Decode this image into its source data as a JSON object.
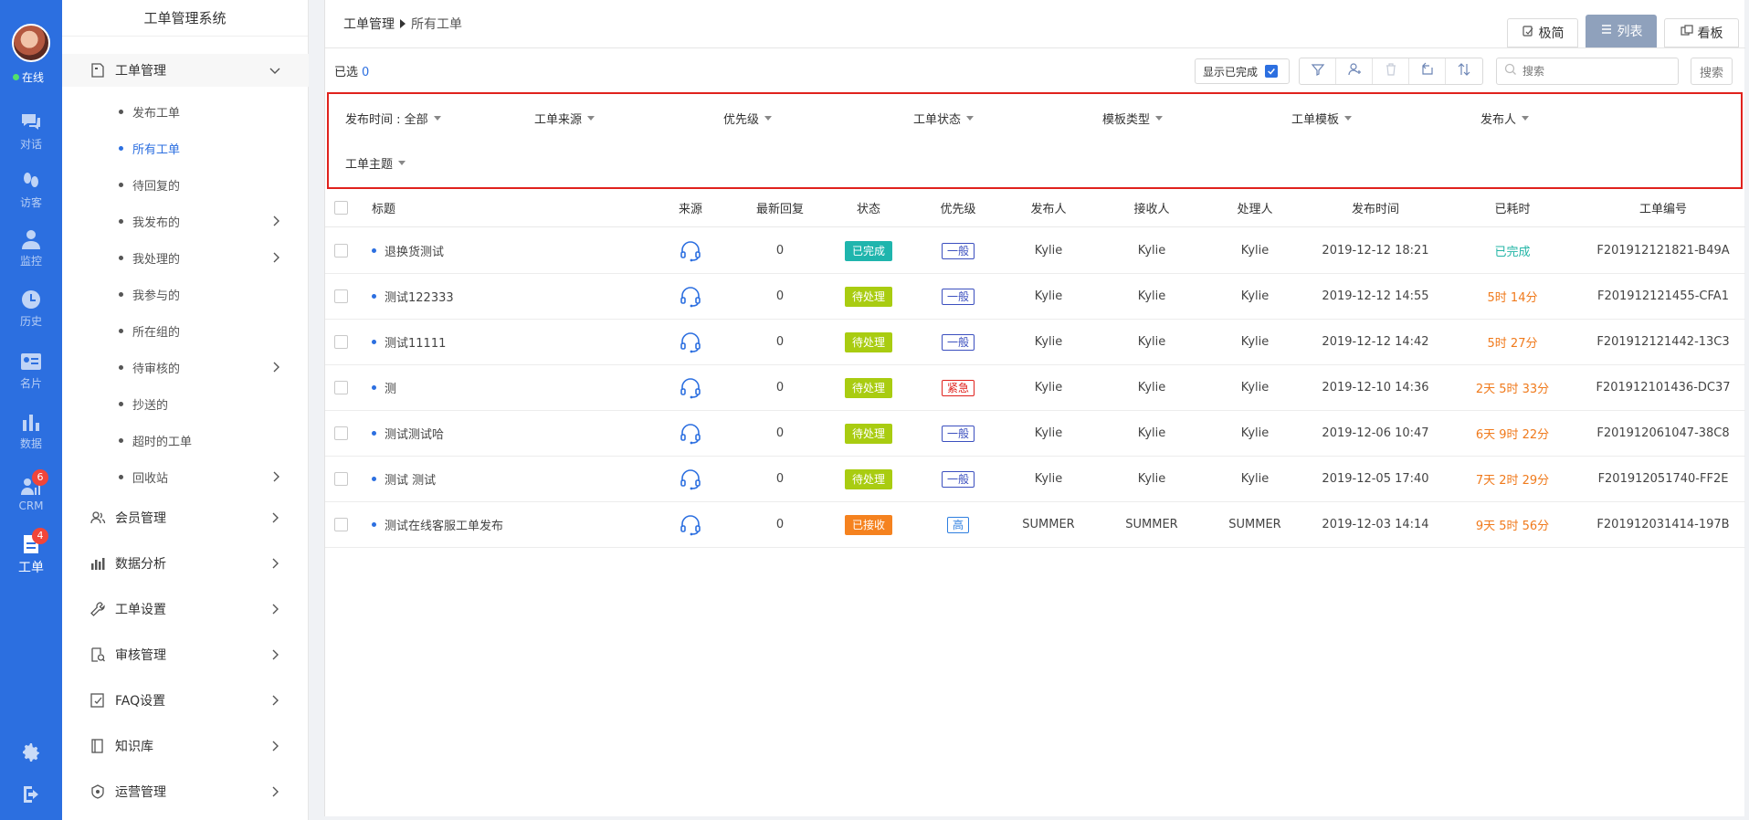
{
  "rail": {
    "status": "在线",
    "items": [
      {
        "label": "对话",
        "icon": "chat-icon",
        "active": false,
        "badge": ""
      },
      {
        "label": "访客",
        "icon": "footprint-icon",
        "active": false,
        "badge": ""
      },
      {
        "label": "监控",
        "icon": "monitor-user-icon",
        "active": false,
        "badge": ""
      },
      {
        "label": "历史",
        "icon": "clock-icon",
        "active": false,
        "badge": ""
      },
      {
        "label": "名片",
        "icon": "id-card-icon",
        "active": false,
        "badge": ""
      },
      {
        "label": "数据",
        "icon": "bar-chart-icon",
        "active": false,
        "badge": ""
      },
      {
        "label": "CRM",
        "icon": "crm-icon",
        "active": false,
        "badge": "6"
      },
      {
        "label": "工单",
        "icon": "ticket-icon",
        "active": true,
        "badge": "4"
      }
    ]
  },
  "sidebar": {
    "title": "工单管理系统",
    "groups": [
      {
        "label": "工单管理",
        "icon": "ticket-icon",
        "open": true
      },
      {
        "label": "会员管理",
        "icon": "members-icon"
      },
      {
        "label": "数据分析",
        "icon": "analytics-icon"
      },
      {
        "label": "工单设置",
        "icon": "wrench-icon"
      },
      {
        "label": "审核管理",
        "icon": "audit-icon"
      },
      {
        "label": "FAQ设置",
        "icon": "faq-icon"
      },
      {
        "label": "知识库",
        "icon": "book-icon"
      },
      {
        "label": "运营管理",
        "icon": "operations-icon"
      }
    ],
    "subitems": [
      {
        "label": "发布工单",
        "active": false,
        "arrow": false
      },
      {
        "label": "所有工单",
        "active": true,
        "arrow": false
      },
      {
        "label": "待回复的",
        "active": false,
        "arrow": false
      },
      {
        "label": "我发布的",
        "active": false,
        "arrow": true
      },
      {
        "label": "我处理的",
        "active": false,
        "arrow": true
      },
      {
        "label": "我参与的",
        "active": false,
        "arrow": false
      },
      {
        "label": "所在组的",
        "active": false,
        "arrow": false
      },
      {
        "label": "待审核的",
        "active": false,
        "arrow": true
      },
      {
        "label": "抄送的",
        "active": false,
        "arrow": false
      },
      {
        "label": "超时的工单",
        "active": false,
        "arrow": false
      },
      {
        "label": "回收站",
        "active": false,
        "arrow": true
      }
    ]
  },
  "header": {
    "breadcrumb": [
      "工单管理",
      "所有工单"
    ],
    "views": [
      {
        "label": "极简",
        "active": false
      },
      {
        "label": "列表",
        "active": true
      },
      {
        "label": "看板",
        "active": false
      }
    ]
  },
  "toolbar": {
    "selected_label": "已选",
    "selected_count": "0",
    "show_completed": "显示已完成",
    "search_placeholder": "搜索",
    "search_button": "搜索"
  },
  "filters": [
    "发布时间 : 全部",
    "工单来源",
    "优先级",
    "工单状态",
    "模板类型",
    "工单模板",
    "发布人",
    "工单主题"
  ],
  "table": {
    "columns": [
      "标题",
      "来源",
      "最新回复",
      "状态",
      "优先级",
      "发布人",
      "接收人",
      "处理人",
      "发布时间",
      "已耗时",
      "工单编号"
    ],
    "rows": [
      {
        "title": "退换货测试",
        "reply": "0",
        "status": "已完成",
        "priority": "一般",
        "publisher": "Kylie",
        "receiver": "Kylie",
        "handler": "Kylie",
        "time": "2019-12-12 18:21",
        "elapsed": "已完成",
        "id": "F201912121821-B49A"
      },
      {
        "title": "测试122333",
        "reply": "0",
        "status": "待处理",
        "priority": "一般",
        "publisher": "Kylie",
        "receiver": "Kylie",
        "handler": "Kylie",
        "time": "2019-12-12 14:55",
        "elapsed": "5时 14分",
        "id": "F201912121455-CFA1"
      },
      {
        "title": "测试11111",
        "reply": "0",
        "status": "待处理",
        "priority": "一般",
        "publisher": "Kylie",
        "receiver": "Kylie",
        "handler": "Kylie",
        "time": "2019-12-12 14:42",
        "elapsed": "5时 27分",
        "id": "F201912121442-13C3"
      },
      {
        "title": "测",
        "reply": "0",
        "status": "待处理",
        "priority": "紧急",
        "publisher": "Kylie",
        "receiver": "Kylie",
        "handler": "Kylie",
        "time": "2019-12-10 14:36",
        "elapsed": "2天 5时 33分",
        "id": "F201912101436-DC37"
      },
      {
        "title": "测试测试哈",
        "reply": "0",
        "status": "待处理",
        "priority": "一般",
        "publisher": "Kylie",
        "receiver": "Kylie",
        "handler": "Kylie",
        "time": "2019-12-06 10:47",
        "elapsed": "6天 9时 22分",
        "id": "F201912061047-38C8"
      },
      {
        "title": "测试 测试",
        "reply": "0",
        "status": "待处理",
        "priority": "一般",
        "publisher": "Kylie",
        "receiver": "Kylie",
        "handler": "Kylie",
        "time": "2019-12-05 17:40",
        "elapsed": "7天 2时 29分",
        "id": "F201912051740-FF2E"
      },
      {
        "title": "测试在线客服工单发布",
        "reply": "0",
        "status": "已接收",
        "priority": "高",
        "publisher": "SUMMER",
        "receiver": "SUMMER",
        "handler": "SUMMER",
        "time": "2019-12-03 14:14",
        "elapsed": "9天 5时 56分",
        "id": "F201912031414-197B"
      }
    ]
  },
  "colors": {
    "accent": "#2c6fe0",
    "status_done": "#1fb5ad",
    "status_pending": "#a9cc11",
    "status_received": "#f5821f",
    "priority_normal": "#3b4fbf",
    "priority_urgent": "#e0221d",
    "priority_high": "#2f7fe0",
    "elapsed_done": "#23b5a6",
    "elapsed_overdue": "#f07a1c",
    "highlight_box": "#e0221d"
  }
}
